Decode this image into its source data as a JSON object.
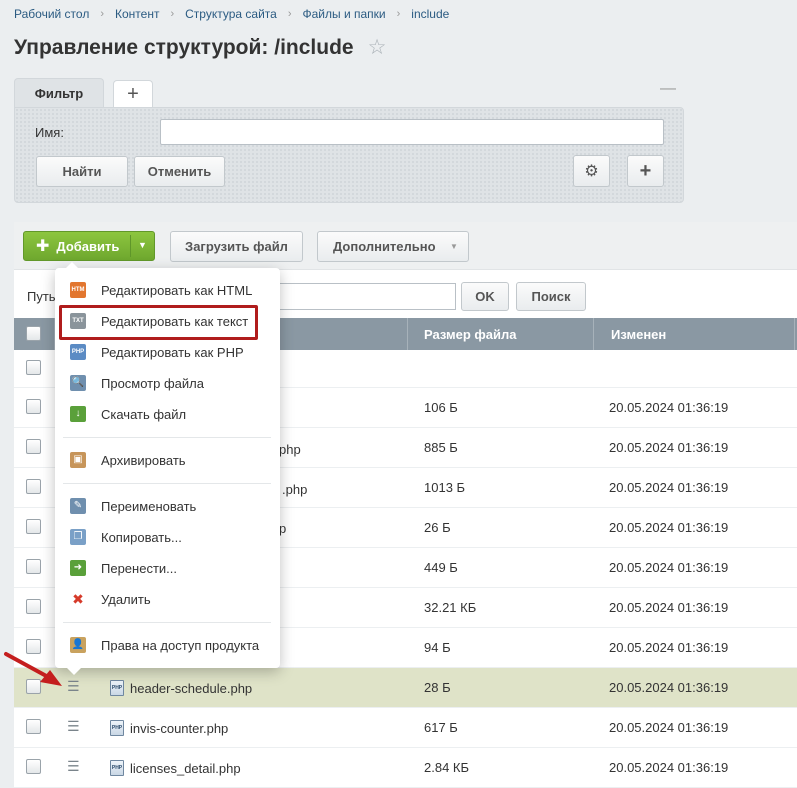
{
  "breadcrumb": [
    "Рабочий стол",
    "Контент",
    "Структура сайта",
    "Файлы и папки",
    "include"
  ],
  "page_title": "Управление структурой: /include",
  "filter": {
    "tab_label": "Фильтр",
    "name_label": "Имя:",
    "find_button": "Найти",
    "cancel_button": "Отменить"
  },
  "toolbar": {
    "add_button": "Добавить",
    "upload_button": "Загрузить файл",
    "more_button": "Дополнительно"
  },
  "path": {
    "label": "Путь",
    "ok_button": "OK",
    "search_button": "Поиск"
  },
  "table": {
    "columns": [
      "Размер файла",
      "Изменен"
    ],
    "rows": [
      {
        "name": "",
        "size": "",
        "date": ""
      },
      {
        "name": "",
        "size": "106 Б",
        "date": "20.05.2024 01:36:19"
      },
      {
        "name": "php",
        "size": "885 Б",
        "date": "20.05.2024 01:36:19"
      },
      {
        "name": ".php",
        "size": "1013 Б",
        "date": "20.05.2024 01:36:19"
      },
      {
        "name": "p",
        "size": "26 Б",
        "date": "20.05.2024 01:36:19"
      },
      {
        "name": "",
        "size": "449 Б",
        "date": "20.05.2024 01:36:19"
      },
      {
        "name": "",
        "size": "32.21 КБ",
        "date": "20.05.2024 01:36:19"
      },
      {
        "name": "",
        "size": "94 Б",
        "date": "20.05.2024 01:36:19"
      },
      {
        "name": "header-schedule.php",
        "size": "28 Б",
        "date": "20.05.2024 01:36:19"
      },
      {
        "name": "invis-counter.php",
        "size": "617 Б",
        "date": "20.05.2024 01:36:19"
      },
      {
        "name": "licenses_detail.php",
        "size": "2.84 КБ",
        "date": "20.05.2024 01:36:19"
      }
    ]
  },
  "context_menu": {
    "items": [
      {
        "label": "Редактировать как HTML",
        "icon": "html-file-icon",
        "color": "#e2762f",
        "tag": "HTM"
      },
      {
        "label": "Редактировать как текст",
        "icon": "text-file-icon",
        "color": "#8a949b",
        "tag": "TXT"
      },
      {
        "label": "Редактировать как PHP",
        "icon": "php-file-icon",
        "color": "#5b8bc4",
        "tag": "PHP"
      },
      {
        "label": "Просмотр файла",
        "icon": "view-file-icon",
        "color": "#6f8fae",
        "tag": ""
      },
      {
        "label": "Скачать файл",
        "icon": "download-icon",
        "color": "#5aa03a",
        "tag": ""
      },
      {
        "label": "Архивировать",
        "icon": "archive-icon",
        "color": "#c7955a",
        "tag": ""
      },
      {
        "label": "Переименовать",
        "icon": "rename-icon",
        "color": "#6f8fae",
        "tag": ""
      },
      {
        "label": "Копировать...",
        "icon": "copy-icon",
        "color": "#7aa0c7",
        "tag": ""
      },
      {
        "label": "Перенести...",
        "icon": "move-icon",
        "color": "#5aa03a",
        "tag": ""
      },
      {
        "label": "Удалить",
        "icon": "delete-icon",
        "color": "#d63a2a",
        "tag": "✖"
      },
      {
        "label": "Права на доступ продукта",
        "icon": "access-rights-icon",
        "color": "#c9a25e",
        "tag": ""
      }
    ]
  },
  "colors": {
    "accent_green": "#7ab535",
    "header_gray": "#8a98a3",
    "highlight_red": "#b01c1c",
    "row_highlight": "#dfe3c8"
  }
}
